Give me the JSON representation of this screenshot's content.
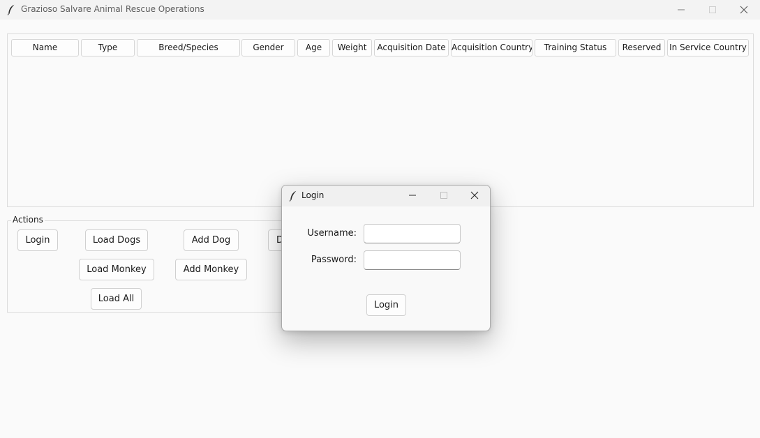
{
  "window": {
    "title": "Grazioso Salvare Animal Rescue Operations",
    "controls": [
      "minimize-icon",
      "maximize-icon",
      "close-icon"
    ]
  },
  "table": {
    "columns": [
      "Name",
      "Type",
      "Breed/Species",
      "Gender",
      "Age",
      "Weight",
      "Acquisition Date",
      "Acquisition Country",
      "Training Status",
      "Reserved",
      "In Service Country"
    ],
    "rows": []
  },
  "actions": {
    "group_label": "Actions",
    "login": "Login",
    "load_dogs": "Load Dogs",
    "add_dog": "Add Dog",
    "partial_button": "D",
    "load_monkey": "Load Monkey",
    "add_monkey": "Add Monkey",
    "load_all": "Load All"
  },
  "login_dialog": {
    "title": "Login",
    "username_label": "Username:",
    "username_value": "",
    "password_label": "Password:",
    "password_value": "",
    "submit": "Login"
  }
}
